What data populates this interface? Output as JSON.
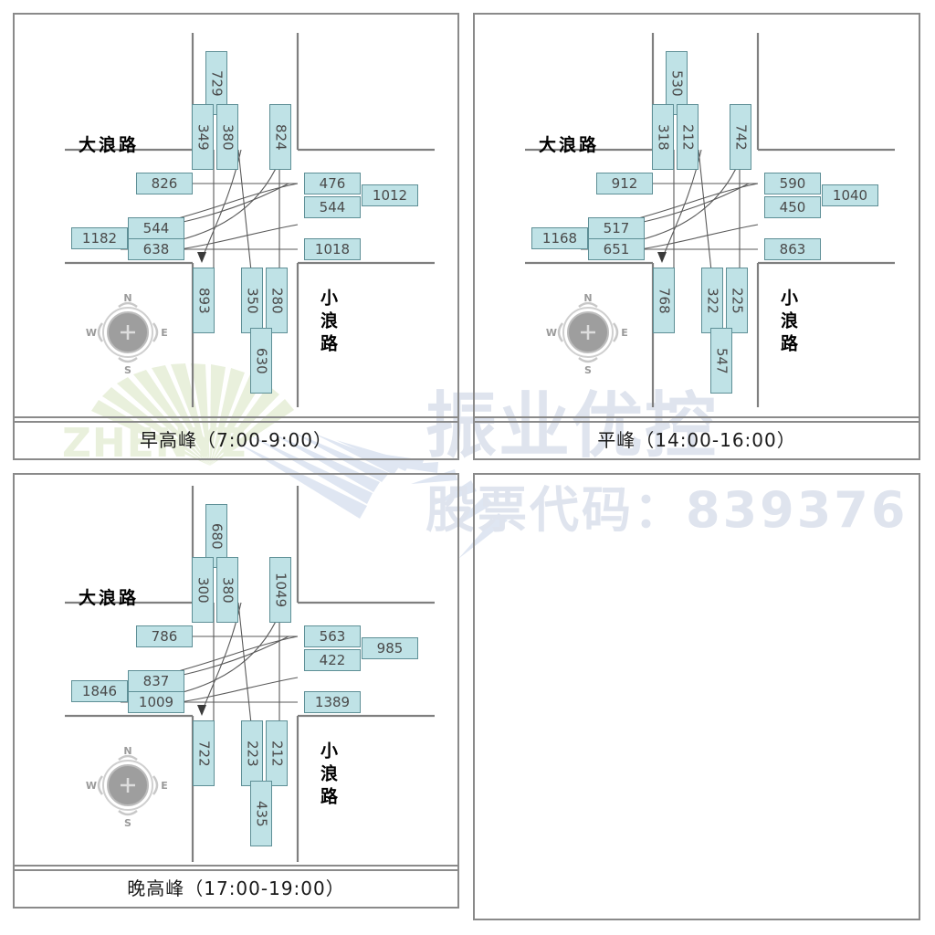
{
  "watermark": {
    "brand": "振业优控",
    "stock_code": "股票代码：839376",
    "logo_text": "ZHENYE"
  },
  "colors": {
    "box_fill": "#bfe2e6",
    "box_border": "#5e8f96",
    "road": "#7f7f7f",
    "panel_border": "#8a8a8a",
    "flow_line": "#4f4f4f",
    "watermark": "#dfe4ee",
    "watermark_green": "#e8efdc"
  },
  "roads": {
    "horizontal": "大浪路",
    "vertical": "小浪路"
  },
  "compass": {
    "north": "N",
    "east": "E",
    "south": "S",
    "west": "W"
  },
  "panels": [
    {
      "id": "panel-1",
      "caption": "早高峰（7:00-9:00）",
      "north_approach": {
        "left_turn": "349",
        "through": "380",
        "right_turn": "729"
      },
      "north_exit": {
        "value": "824"
      },
      "south_approach": {
        "left_turn": "350",
        "through": "280",
        "right_turn": "630"
      },
      "south_exit": {
        "value": "893"
      },
      "west_exit": {
        "value": "826"
      },
      "west_approach": {
        "through": "544",
        "right_or_second": "638",
        "total": "1182"
      },
      "east_approach": {
        "through": "476",
        "second": "544",
        "total": "1012"
      },
      "east_exit": {
        "value": "1018"
      }
    },
    {
      "id": "panel-2",
      "caption": "平峰（14:00-16:00）",
      "north_approach": {
        "left_turn": "318",
        "through": "212",
        "right_turn": "530"
      },
      "north_exit": {
        "value": "742"
      },
      "south_approach": {
        "left_turn": "322",
        "through": "225",
        "right_turn": "547"
      },
      "south_exit": {
        "value": "768"
      },
      "west_exit": {
        "value": "912"
      },
      "west_approach": {
        "through": "517",
        "right_or_second": "651",
        "total": "1168"
      },
      "east_approach": {
        "through": "590",
        "second": "450",
        "total": "1040"
      },
      "east_exit": {
        "value": "863"
      }
    },
    {
      "id": "panel-3",
      "caption": "晚高峰（17:00-19:00）",
      "north_approach": {
        "left_turn": "300",
        "through": "380",
        "right_turn": "680"
      },
      "north_exit": {
        "value": "1049"
      },
      "south_approach": {
        "left_turn": "223",
        "through": "212",
        "right_turn": "435"
      },
      "south_exit": {
        "value": "722"
      },
      "west_exit": {
        "value": "786"
      },
      "west_approach": {
        "through": "837",
        "right_or_second": "1009",
        "total": "1846"
      },
      "east_approach": {
        "through": "563",
        "second": "422",
        "total": "985"
      },
      "east_exit": {
        "value": "1389"
      }
    },
    {
      "id": "panel-4",
      "caption": "",
      "empty": true
    }
  ]
}
